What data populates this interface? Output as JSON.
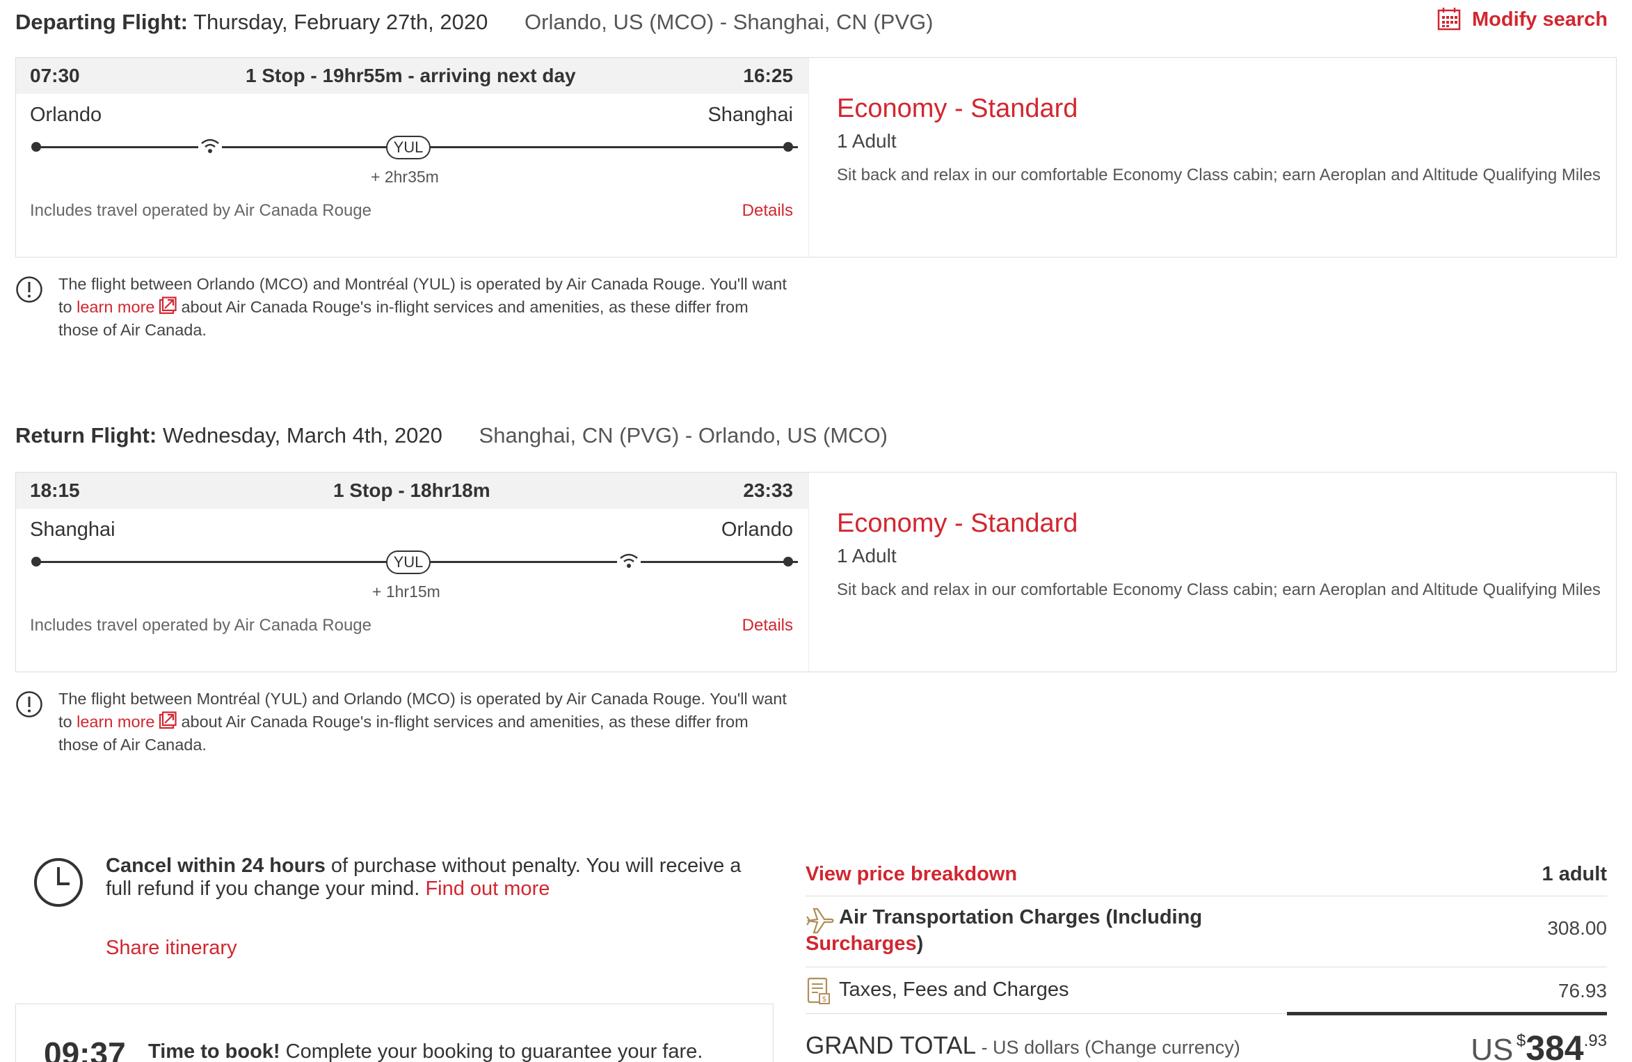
{
  "header": {
    "modify_search": "Modify search"
  },
  "departing": {
    "label": "Departing Flight:",
    "date": "Thursday, February 27th, 2020",
    "route": "Orlando, US (MCO) - Shanghai, CN (PVG)",
    "depart_time": "07:30",
    "summary": "1 Stop - 19hr55m - arriving next day",
    "arrive_time": "16:25",
    "origin_city": "Orlando",
    "dest_city": "Shanghai",
    "stop_code": "YUL",
    "layover": "+ 2hr35m",
    "operated": "Includes travel operated by Air Canada Rouge",
    "details": "Details",
    "fare_name": "Economy - Standard",
    "pax": "1 Adult",
    "fare_desc": "Sit back and relax in our comfortable Economy Class cabin; earn Aeroplan and Altitude Qualifying Miles",
    "notice_1": "The flight between Orlando (MCO) and Montréal (YUL) is operated by Air Canada Rouge. You'll want",
    "notice_to": "to",
    "notice_link": "learn more",
    "notice_2": "about Air Canada Rouge's in-flight services and amenities, as these differ from",
    "notice_3": "those of Air Canada."
  },
  "return": {
    "label": "Return Flight:",
    "date": "Wednesday, March 4th, 2020",
    "route": "Shanghai, CN (PVG) - Orlando, US (MCO)",
    "depart_time": "18:15",
    "summary": "1 Stop - 18hr18m",
    "arrive_time": "23:33",
    "origin_city": "Shanghai",
    "dest_city": "Orlando",
    "stop_code": "YUL",
    "layover": "+ 1hr15m",
    "operated": "Includes travel operated by Air Canada Rouge",
    "details": "Details",
    "fare_name": "Economy - Standard",
    "pax": "1 Adult",
    "fare_desc": "Sit back and relax in our comfortable Economy Class cabin; earn Aeroplan and Altitude Qualifying Miles",
    "notice_1": "The flight between Montréal (YUL) and Orlando (MCO) is operated by Air Canada Rouge. You'll want",
    "notice_to": "to",
    "notice_link": "learn more",
    "notice_2": "about Air Canada Rouge's in-flight services and amenities, as these differ from",
    "notice_3": "those of Air Canada."
  },
  "cancel": {
    "bold": "Cancel within 24 hours",
    "text": " of purchase without penalty. You will receive a full refund if you change your mind.",
    "link": "Find out more"
  },
  "share": "Share itinerary",
  "booking": {
    "timer": "09:37",
    "bold": "Time to book!",
    "text": " Complete your booking to guarantee your fare."
  },
  "price": {
    "view_breakdown": "View price breakdown",
    "count": "1 adult",
    "air_label_a": "Air Transportation Charges (Including",
    "air_label_b": "Surcharges",
    "air_label_c": ")",
    "air_amount": "308.00",
    "tax_label": "Taxes, Fees and Charges",
    "tax_amount": "76.93",
    "grand_label": "GRAND TOTAL",
    "grand_sub_a": " - US dollars (",
    "change_currency": "Change currency",
    "grand_sub_b": ")",
    "currency": "US",
    "symbol": "$",
    "dollars": "384",
    "cents": ".93"
  },
  "colors": {
    "accent": "#d22630",
    "text": "#333333",
    "header_bg": "#f2f2f2"
  }
}
